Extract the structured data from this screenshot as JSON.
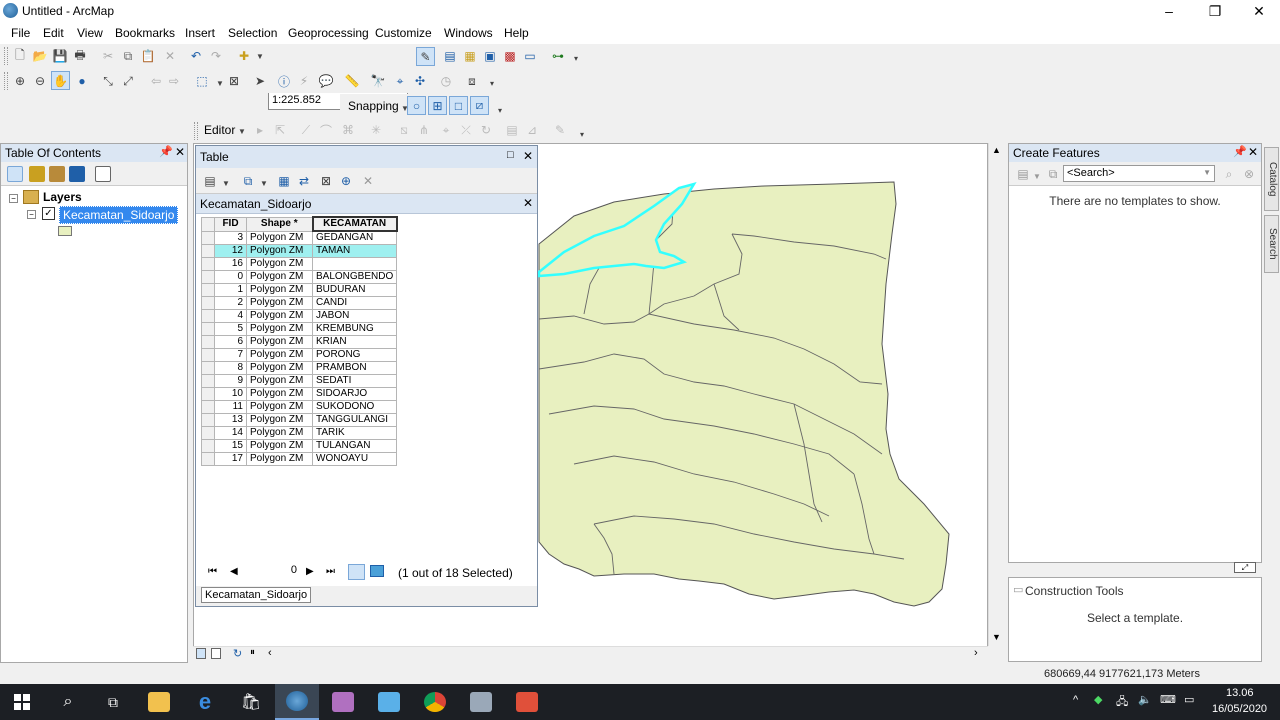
{
  "window": {
    "title": "Untitled - ArcMap",
    "min": "–",
    "max": "❐",
    "close": "✕"
  },
  "menu": [
    "File",
    "Edit",
    "View",
    "Bookmarks",
    "Insert",
    "Selection",
    "Geoprocessing",
    "Customize",
    "Windows",
    "Help"
  ],
  "toolbar": {
    "scale": "1:225.852",
    "snapping_label": "Snapping",
    "editor_label": "Editor"
  },
  "toc": {
    "title": "Table Of Contents",
    "layers_label": "Layers",
    "layer_name": "Kecamatan_Sidoarjo"
  },
  "table": {
    "title": "Table",
    "layer_name": "Kecamatan_Sidoarjo",
    "columns": [
      "FID",
      "Shape *",
      "KECAMATAN"
    ],
    "rows": [
      {
        "fid": "3",
        "shape": "Polygon ZM",
        "kec": "GEDANGAN"
      },
      {
        "fid": "12",
        "shape": "Polygon ZM",
        "kec": "TAMAN"
      },
      {
        "fid": "16",
        "shape": "Polygon ZM",
        "kec": ""
      },
      {
        "fid": "0",
        "shape": "Polygon ZM",
        "kec": "BALONGBENDO"
      },
      {
        "fid": "1",
        "shape": "Polygon ZM",
        "kec": "BUDURAN"
      },
      {
        "fid": "2",
        "shape": "Polygon ZM",
        "kec": "CANDI"
      },
      {
        "fid": "4",
        "shape": "Polygon ZM",
        "kec": "JABON"
      },
      {
        "fid": "5",
        "shape": "Polygon ZM",
        "kec": "KREMBUNG"
      },
      {
        "fid": "6",
        "shape": "Polygon ZM",
        "kec": "KRIAN"
      },
      {
        "fid": "7",
        "shape": "Polygon ZM",
        "kec": "PORONG"
      },
      {
        "fid": "8",
        "shape": "Polygon ZM",
        "kec": "PRAMBON"
      },
      {
        "fid": "9",
        "shape": "Polygon ZM",
        "kec": "SEDATI"
      },
      {
        "fid": "10",
        "shape": "Polygon ZM",
        "kec": "SIDOARJO"
      },
      {
        "fid": "11",
        "shape": "Polygon ZM",
        "kec": "SUKODONO"
      },
      {
        "fid": "13",
        "shape": "Polygon ZM",
        "kec": "TANGGULANGI"
      },
      {
        "fid": "14",
        "shape": "Polygon ZM",
        "kec": "TARIK"
      },
      {
        "fid": "15",
        "shape": "Polygon ZM",
        "kec": "TULANGAN"
      },
      {
        "fid": "17",
        "shape": "Polygon ZM",
        "kec": "WONOAYU"
      }
    ],
    "selected_fid": "12",
    "record_index": "0",
    "selection_status": "(1 out of 18 Selected)",
    "tab_label": "Kecamatan_Sidoarjo"
  },
  "create_features": {
    "title": "Create Features",
    "search_placeholder": "<Search>",
    "empty_message": "There are no templates to show."
  },
  "construction_tools": {
    "title": "Construction Tools",
    "message": "Select a template."
  },
  "side_tabs": [
    "Catalog",
    "Search"
  ],
  "status": {
    "coordinates": "680669,44  9177621,173 Meters"
  },
  "taskbar": {
    "time": "13.06",
    "date": "16/05/2020"
  },
  "colors": {
    "map_fill": "#e8f0c0",
    "selection": "#33ffff",
    "panel_header": "#dbe6f3"
  }
}
